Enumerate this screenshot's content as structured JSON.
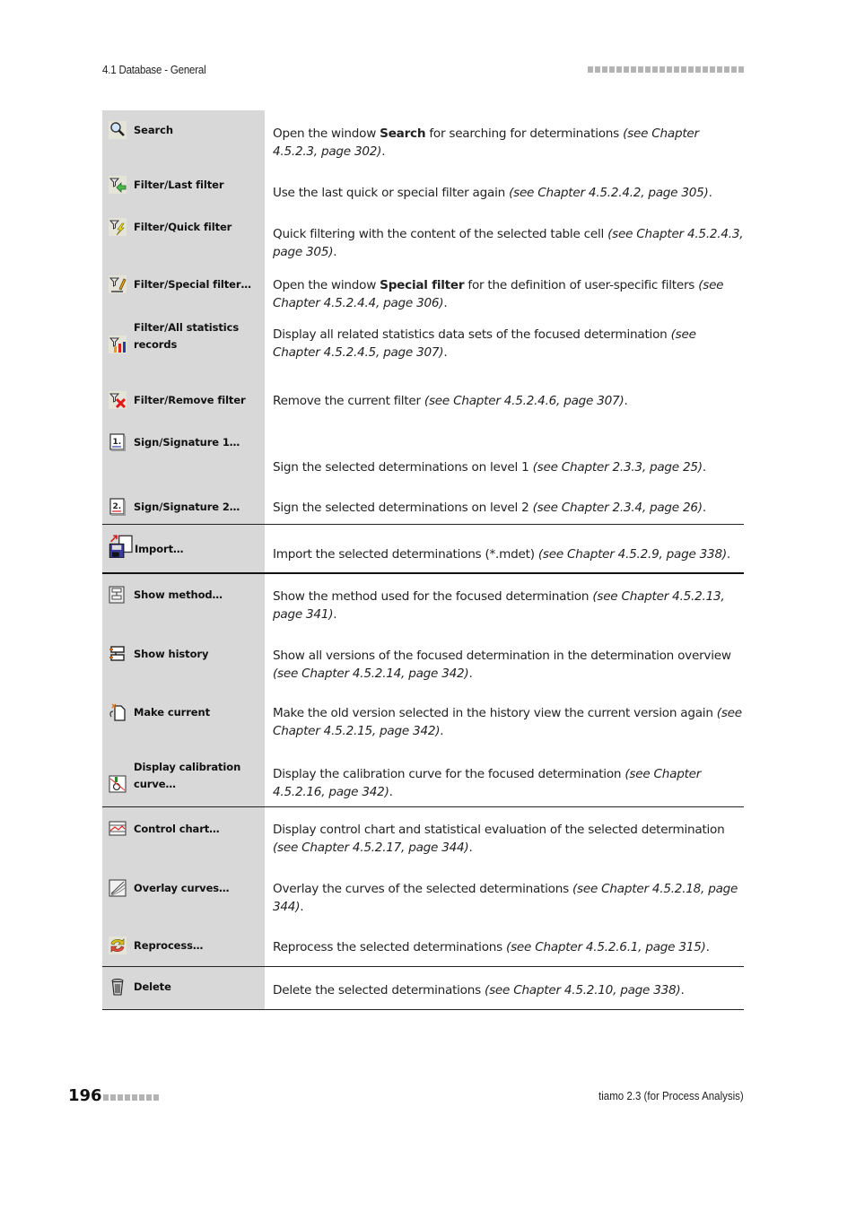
{
  "header": {
    "section": "4.1 Database - General",
    "dot_count": 22
  },
  "rows": [
    {
      "label": "Search",
      "icon": "search-icon",
      "desc": [
        {
          "t": "Open the window "
        },
        {
          "t": "Search",
          "s": "b"
        },
        {
          "t": " for searching for determinations "
        },
        {
          "t": "(see Chapter 4.5.2.3, page 302)",
          "s": "i"
        },
        {
          "t": "."
        }
      ]
    },
    {
      "label": "Filter/Last filter",
      "icon": "filter-last-icon",
      "desc": [
        {
          "t": "Use the last quick or special filter again "
        },
        {
          "t": "(see Chapter 4.5.2.4.2, page 305)",
          "s": "i"
        },
        {
          "t": "."
        }
      ]
    },
    {
      "label": "Filter/Quick filter",
      "icon": "filter-quick-icon",
      "desc": [
        {
          "t": "Quick filtering with the content of the selected table cell "
        },
        {
          "t": "(see Chapter 4.5.2.4.3, page 305)",
          "s": "i"
        },
        {
          "t": "."
        }
      ]
    },
    {
      "label": "Filter/Special filter…",
      "icon": "filter-special-icon",
      "desc": [
        {
          "t": "Open the window "
        },
        {
          "t": "Special filter",
          "s": "b"
        },
        {
          "t": " for the definition of user-specific filters "
        },
        {
          "t": "(see Chapter 4.5.2.4.4, page 306)",
          "s": "i"
        },
        {
          "t": "."
        }
      ]
    },
    {
      "label": "Filter/All statistics records",
      "icon": "filter-statistics-icon",
      "desc": [
        {
          "t": "Display all related statistics data sets of the focused determination "
        },
        {
          "t": "(see Chapter 4.5.2.4.5, page 307)",
          "s": "i"
        },
        {
          "t": "."
        }
      ]
    },
    {
      "label": "Filter/Remove filter",
      "icon": "filter-remove-icon",
      "desc": [
        {
          "t": "Remove the current filter "
        },
        {
          "t": "(see Chapter 4.5.2.4.6, page 307)",
          "s": "i"
        },
        {
          "t": "."
        }
      ]
    },
    {
      "label": "Sign/Signature 1…",
      "icon": "signature-1-icon",
      "desc": [
        {
          "t": "Sign the selected determinations on level 1 "
        },
        {
          "t": "(see Chapter 2.3.3, page 25)",
          "s": "i"
        },
        {
          "t": "."
        }
      ]
    },
    {
      "label": "Sign/Signature 2…",
      "icon": "signature-2-icon",
      "desc": [
        {
          "t": "Sign the selected determinations on level 2 "
        },
        {
          "t": "(see Chapter 2.3.4, page 26)",
          "s": "i"
        },
        {
          "t": "."
        }
      ]
    },
    {
      "label": "Import…",
      "icon": "import-icon",
      "desc": [
        {
          "t": "Import the selected determinations (*.mdet) "
        },
        {
          "t": "(see Chapter 4.5.2.9, page 338)",
          "s": "i"
        },
        {
          "t": "."
        }
      ]
    },
    {
      "label": "Show method…",
      "icon": "show-method-icon",
      "desc": [
        {
          "t": "Show the method used for the focused determination "
        },
        {
          "t": "(see Chapter 4.5.2.13, page 341)",
          "s": "i"
        },
        {
          "t": "."
        }
      ]
    },
    {
      "label": "Show history",
      "icon": "show-history-icon",
      "desc": [
        {
          "t": "Show all versions of the focused determination in the determination overview "
        },
        {
          "t": "(see Chapter 4.5.2.14, page 342)",
          "s": "i"
        },
        {
          "t": "."
        }
      ]
    },
    {
      "label": "Make current",
      "icon": "make-current-icon",
      "desc": [
        {
          "t": "Make the old version selected in the history view the current version again "
        },
        {
          "t": "(see Chapter 4.5.2.15, page 342)",
          "s": "i"
        },
        {
          "t": "."
        }
      ]
    },
    {
      "label": "Display calibration curve…",
      "icon": "calibration-curve-icon",
      "desc": [
        {
          "t": "Display the calibration curve for the focused determination "
        },
        {
          "t": "(see Chapter 4.5.2.16, page 342)",
          "s": "i"
        },
        {
          "t": "."
        }
      ]
    },
    {
      "label": "Control chart…",
      "icon": "control-chart-icon",
      "desc": [
        {
          "t": "Display control chart and statistical evaluation of the selected determination "
        },
        {
          "t": "(see Chapter 4.5.2.17, page 344)",
          "s": "i"
        },
        {
          "t": "."
        }
      ]
    },
    {
      "label": "Overlay curves…",
      "icon": "overlay-curves-icon",
      "desc": [
        {
          "t": "Overlay the curves of the selected determinations "
        },
        {
          "t": "(see Chapter 4.5.2.18, page 344)",
          "s": "i"
        },
        {
          "t": "."
        }
      ]
    },
    {
      "label": "Reprocess…",
      "icon": "reprocess-icon",
      "desc": [
        {
          "t": "Reprocess the selected determinations "
        },
        {
          "t": "(see Chapter 4.5.2.6.1, page 315)",
          "s": "i"
        },
        {
          "t": "."
        }
      ]
    },
    {
      "label": "Delete",
      "icon": "delete-icon",
      "desc": [
        {
          "t": "Delete the selected determinations "
        },
        {
          "t": "(see Chapter 4.5.2.10, page 338)",
          "s": "i"
        },
        {
          "t": "."
        }
      ]
    }
  ],
  "footer": {
    "page_number": "196",
    "dot_count": 8,
    "product": "tiamo 2.3 (for Process Analysis)"
  },
  "colors": {
    "left_column_bg": "#d8d8d8",
    "header_dots": "#b4b4b4"
  }
}
